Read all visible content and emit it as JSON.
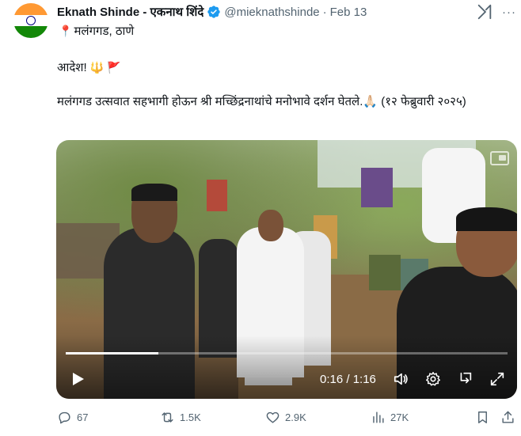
{
  "tweet": {
    "author_name": "Eknath Shinde - एकनाथ शिंदे",
    "handle": "@mieknathshinde",
    "separator": "·",
    "date": "Feb 13",
    "more_label": "···",
    "location": "मलंगगड, ठाणे",
    "line1": "आदेश!",
    "line1_emojis": [
      "🔱",
      "🚩"
    ],
    "body": "मलंगगड उत्सवात सहभागी होऊन श्री मच्छिंद्रनाथांचे मनोभावे दर्शन घेतले.🙏🏻 (१२ फेब्रुवारी २०२५)"
  },
  "video": {
    "current_time": "0:16",
    "duration": "1:16",
    "time_display": "0:16 / 1:16",
    "progress_fraction": 0.21
  },
  "actions": {
    "replies": "67",
    "reposts": "1.5K",
    "likes": "2.9K",
    "views": "27K"
  },
  "colors": {
    "verified_blue": "#1d9bf0",
    "secondary_text": "#536471",
    "primary_text": "#0f1419"
  },
  "icons": {
    "verified": "verified-badge-icon",
    "grok": "grok-icon",
    "location": "pin-icon",
    "play": "play-icon",
    "volume": "volume-icon",
    "settings": "gear-icon",
    "fullscreen": "fullscreen-icon",
    "reply": "reply-icon",
    "repost": "repost-icon",
    "like": "heart-icon",
    "views": "views-icon",
    "bookmark": "bookmark-icon",
    "share": "share-icon"
  }
}
